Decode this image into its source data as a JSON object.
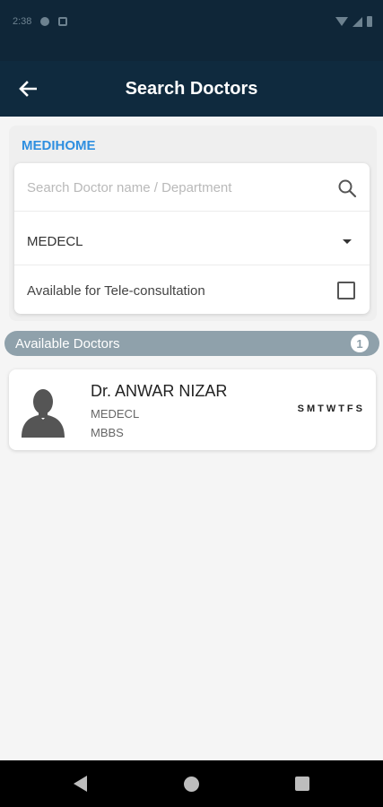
{
  "status_bar": {
    "time": "2:38"
  },
  "app_bar": {
    "title": "Search Doctors",
    "back_icon": "arrow-left-icon"
  },
  "search_panel": {
    "brand": "MEDIHOME",
    "search": {
      "placeholder": "Search Doctor name / Department",
      "value": ""
    },
    "department": {
      "selected": "MEDECL"
    },
    "tele_consultation": {
      "label": "Available for Tele-consultation",
      "checked": false
    }
  },
  "available": {
    "label": "Available Doctors",
    "count": "1"
  },
  "doctors": [
    {
      "name": "Dr. ANWAR NIZAR",
      "department": "MEDECL",
      "qualification": "MBBS",
      "days": "SMTWTFS"
    }
  ],
  "colors": {
    "app_bar": "#0f2a3e",
    "status_bar": "#0f2638",
    "brand_blue": "#2f8fe0",
    "available_bar": "#8fa1ab"
  }
}
